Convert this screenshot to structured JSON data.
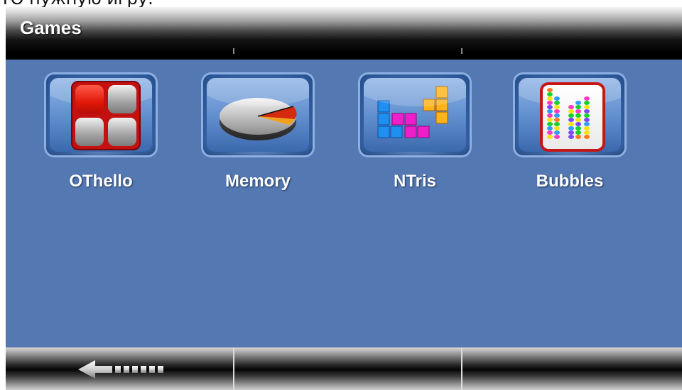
{
  "page": {
    "caption": "ТО нужную игру."
  },
  "header": {
    "title": "Games"
  },
  "games": [
    {
      "label": "OThello",
      "icon": "othello-icon"
    },
    {
      "label": "Memory",
      "icon": "memory-pie-icon"
    },
    {
      "label": "NTris",
      "icon": "ntris-blocks-icon"
    },
    {
      "label": "Bubbles",
      "icon": "bubbles-icon"
    }
  ],
  "footer": {
    "back_icon": "back-arrow-icon"
  },
  "colors": {
    "content_bg": "#5478b2",
    "label": "#ffffff"
  }
}
